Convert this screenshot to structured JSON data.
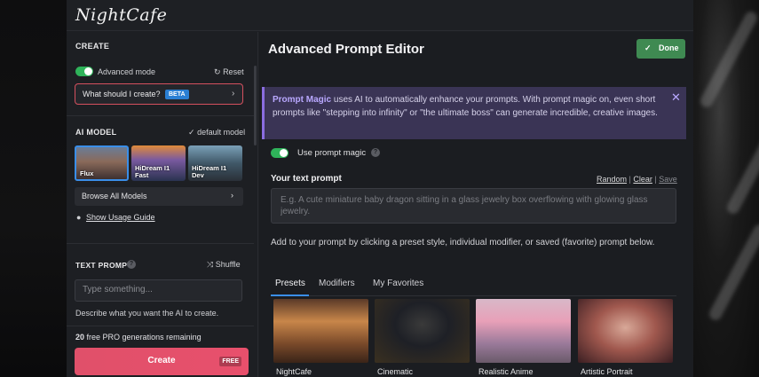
{
  "app": {
    "logo": "NightCafe"
  },
  "sidebar": {
    "create_title": "CREATE",
    "advanced_mode_label": "Advanced mode",
    "reset_label": "Reset",
    "suggest_label": "What should I create?",
    "beta_badge": "BETA",
    "ai_model_title": "AI MODEL",
    "default_model_label": "default model",
    "models": [
      {
        "label": "Flux"
      },
      {
        "label": "HiDream I1 Fast"
      },
      {
        "label": "HiDream I1 Dev"
      }
    ],
    "browse_models_label": "Browse All Models",
    "usage_guide_label": "Show Usage Guide",
    "text_prompt_title": "TEXT PROMPT",
    "shuffle_label": "Shuffle",
    "text_prompt_placeholder": "Type something...",
    "text_prompt_help": "Describe what you want the AI to create.",
    "pro_count": "20",
    "pro_remaining_label": "free PRO generations remaining",
    "create_button_label": "Create",
    "free_badge": "FREE"
  },
  "editor": {
    "title": "Advanced Prompt Editor",
    "done_label": "Done",
    "banner_title": "Prompt Magic",
    "banner_text": "uses AI to automatically enhance your prompts. With prompt magic on, even short prompts like \"stepping into infinity\" or \"the ultimate boss\" can generate incredible, creative images.",
    "use_magic_label": "Use prompt magic",
    "text_prompt_label": "Your text prompt",
    "random_label": "Random",
    "clear_label": "Clear",
    "save_label": "Save",
    "prompt_placeholder": "E.g. A cute miniature baby dragon sitting in a glass jewelry box overflowing with glowing glass jewelry.",
    "add_prompt_text": "Add to your prompt by clicking a preset style, individual modifier, or saved (favorite) prompt below.",
    "tabs": [
      {
        "label": "Presets"
      },
      {
        "label": "Modifiers"
      },
      {
        "label": "My Favorites"
      }
    ],
    "presets": [
      {
        "label": "NightCafe"
      },
      {
        "label": "Cinematic"
      },
      {
        "label": "Realistic Anime"
      },
      {
        "label": "Artistic Portrait"
      }
    ]
  },
  "colors": {
    "accent_green": "#2fb35a",
    "accent_pink": "#e0506a",
    "accent_blue": "#3a8ee8",
    "magic_purple": "#8a6de0"
  }
}
